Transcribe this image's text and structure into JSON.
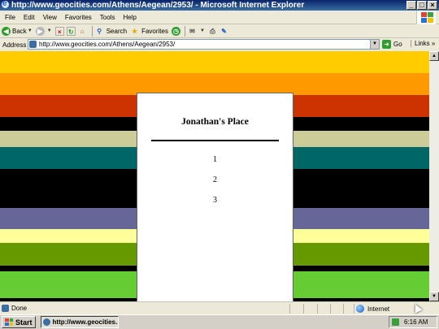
{
  "window": {
    "title": "http://www.geocities.com/Athens/Aegean/2953/ - Microsoft Internet Explorer",
    "minimize_label": "_",
    "maximize_label": "□",
    "close_label": "×"
  },
  "menu": {
    "items": [
      {
        "label": "File"
      },
      {
        "label": "Edit"
      },
      {
        "label": "View"
      },
      {
        "label": "Favorites"
      },
      {
        "label": "Tools"
      },
      {
        "label": "Help"
      }
    ]
  },
  "toolbar": {
    "back_label": "Back",
    "search_label": "Search",
    "favorites_label": "Favorites"
  },
  "address": {
    "label": "Address",
    "url": "http://www.geocities.com/Athens/Aegean/2953/",
    "go_label": "Go",
    "links_label": "Links",
    "links_more": "»"
  },
  "page": {
    "title": "Jonathan's Place",
    "links": [
      {
        "label": "1"
      },
      {
        "label": "2"
      },
      {
        "label": "3"
      }
    ],
    "stripe_colors": [
      "#ffcc00",
      "#ff9900",
      "#cc3300",
      "#000000",
      "#cccc99",
      "#006666",
      "#000000",
      "#666699",
      "#ffff99",
      "#669900",
      "#000000",
      "#66cc33"
    ]
  },
  "status": {
    "text": "Done",
    "zone": "Internet"
  },
  "taskbar": {
    "start_label": "Start",
    "task_label": "http://www.geocities....",
    "clock": "6:16 AM"
  }
}
